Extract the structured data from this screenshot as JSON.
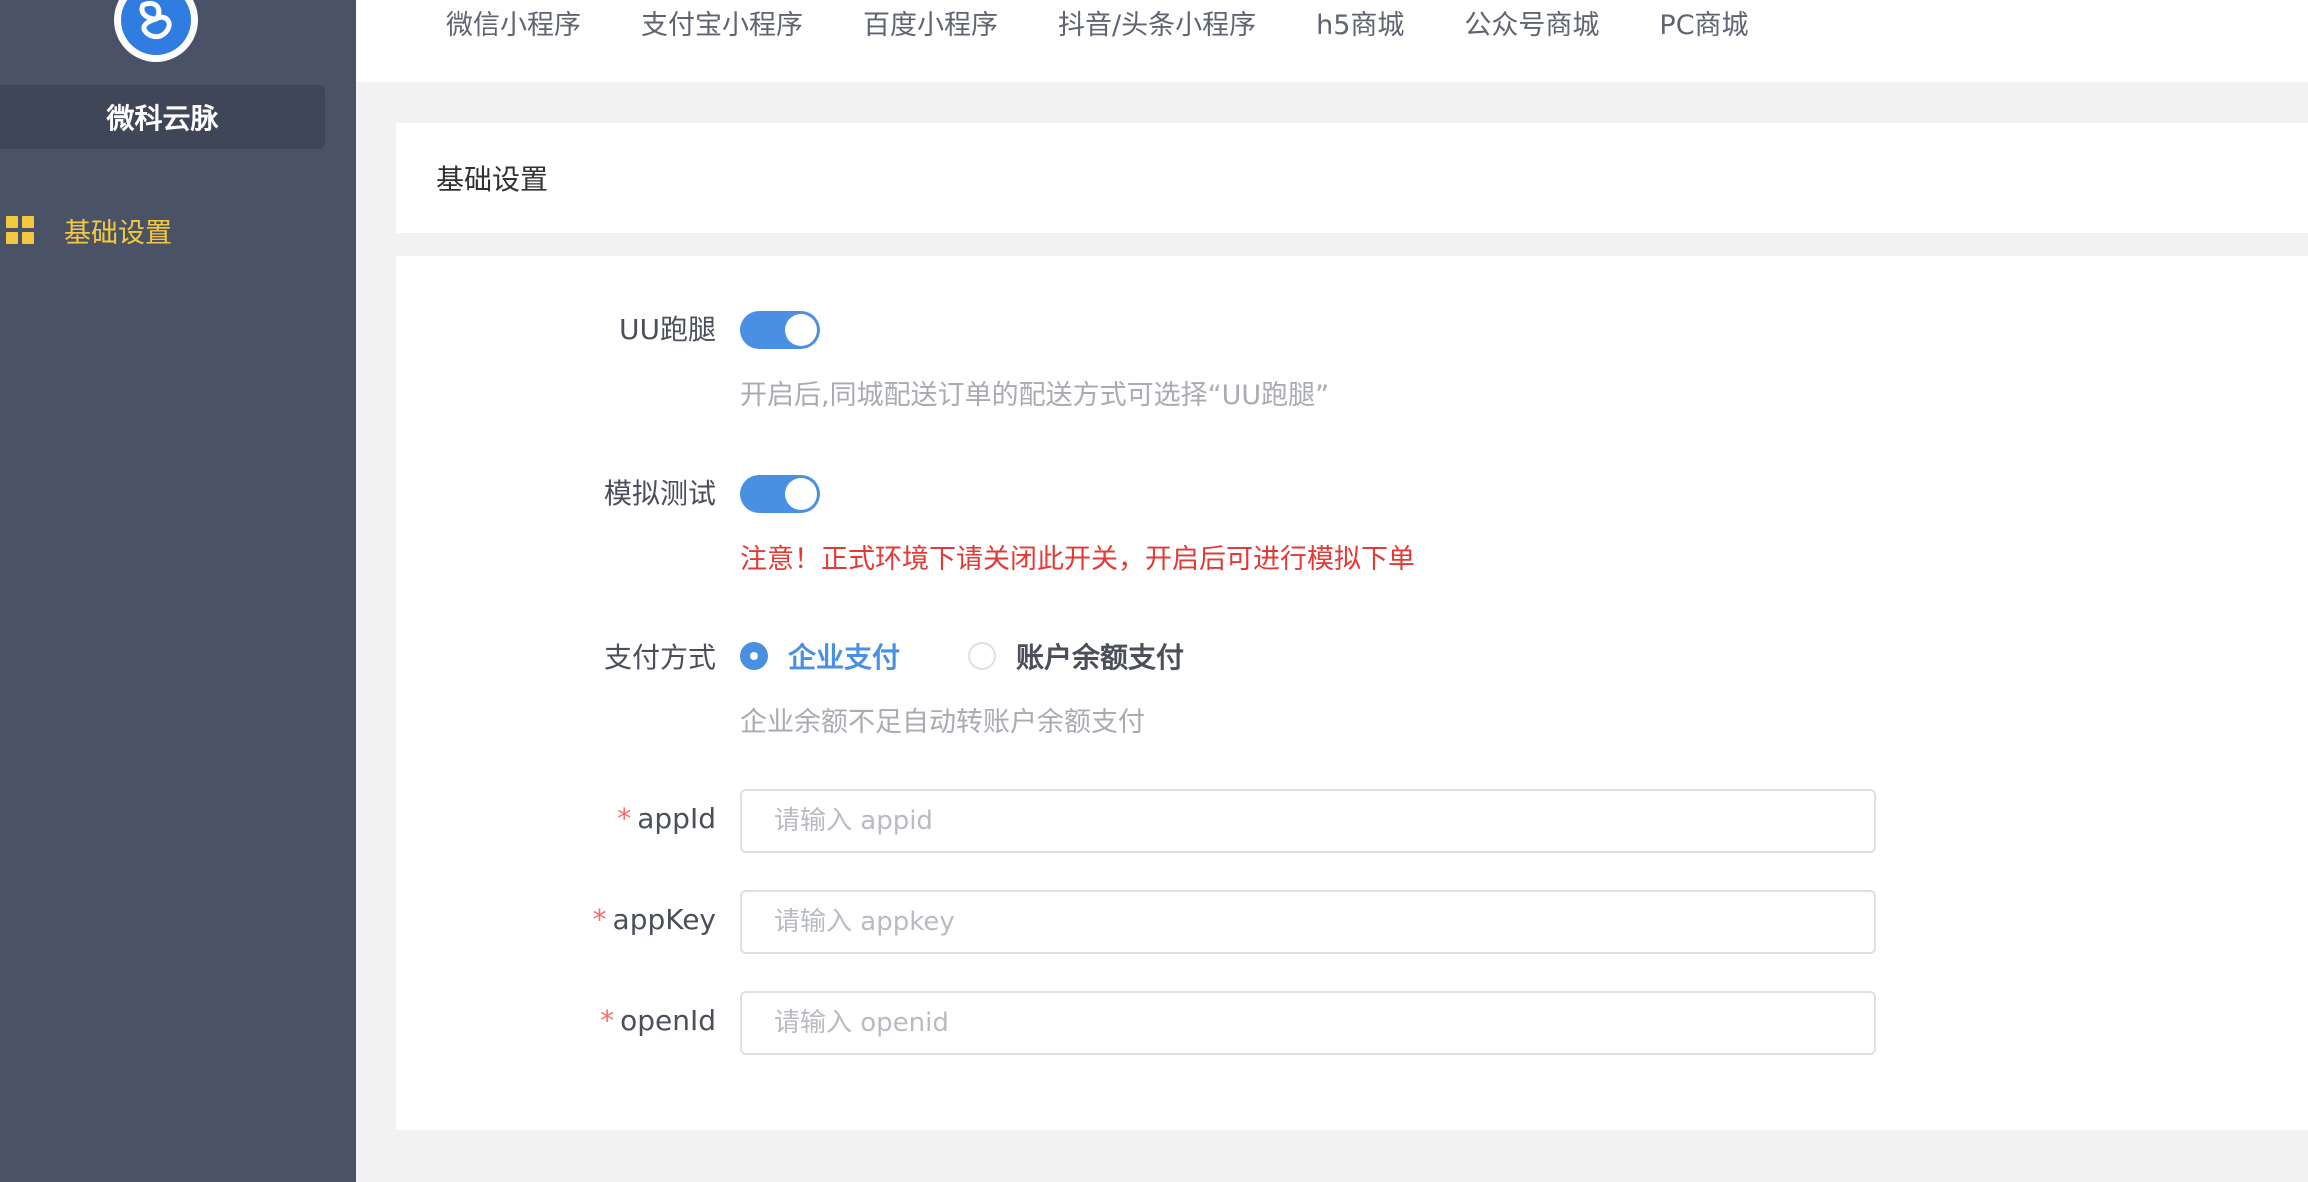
{
  "brand": {
    "name": "微科云脉"
  },
  "sidebar": {
    "items": [
      {
        "label": "基础设置",
        "icon": "grid-icon",
        "active": true
      }
    ]
  },
  "tabs": [
    {
      "label": "微信小程序"
    },
    {
      "label": "支付宝小程序"
    },
    {
      "label": "百度小程序"
    },
    {
      "label": "抖音/头条小程序"
    },
    {
      "label": "h5商城"
    },
    {
      "label": "公众号商城"
    },
    {
      "label": "PC商城"
    }
  ],
  "section": {
    "title": "基础设置"
  },
  "form": {
    "uu": {
      "label": "UU跑腿",
      "enabled": true,
      "hint": "开启后,同城配送订单的配送方式可选择“UU跑腿”"
    },
    "test": {
      "label": "模拟测试",
      "enabled": true,
      "warning": "注意！正式环境下请关闭此开关，开启后可进行模拟下单"
    },
    "pay": {
      "label": "支付方式",
      "options": [
        {
          "label": "企业支付",
          "checked": true
        },
        {
          "label": "账户余额支付",
          "checked": false
        }
      ],
      "hint": "企业余额不足自动转账户余额支付"
    },
    "appid": {
      "required_mark": "*",
      "label": "appId",
      "value": "",
      "placeholder": "请输入 appid"
    },
    "appkey": {
      "required_mark": "*",
      "label": "appKey",
      "value": "",
      "placeholder": "请输入 appkey"
    },
    "openid": {
      "required_mark": "*",
      "label": "openId",
      "value": "",
      "placeholder": "请输入 openid"
    }
  },
  "colors": {
    "sidebar_bg": "#4a5366",
    "accent": "#4a90e2",
    "menu_active": "#f5c842",
    "warning": "#e53935"
  }
}
